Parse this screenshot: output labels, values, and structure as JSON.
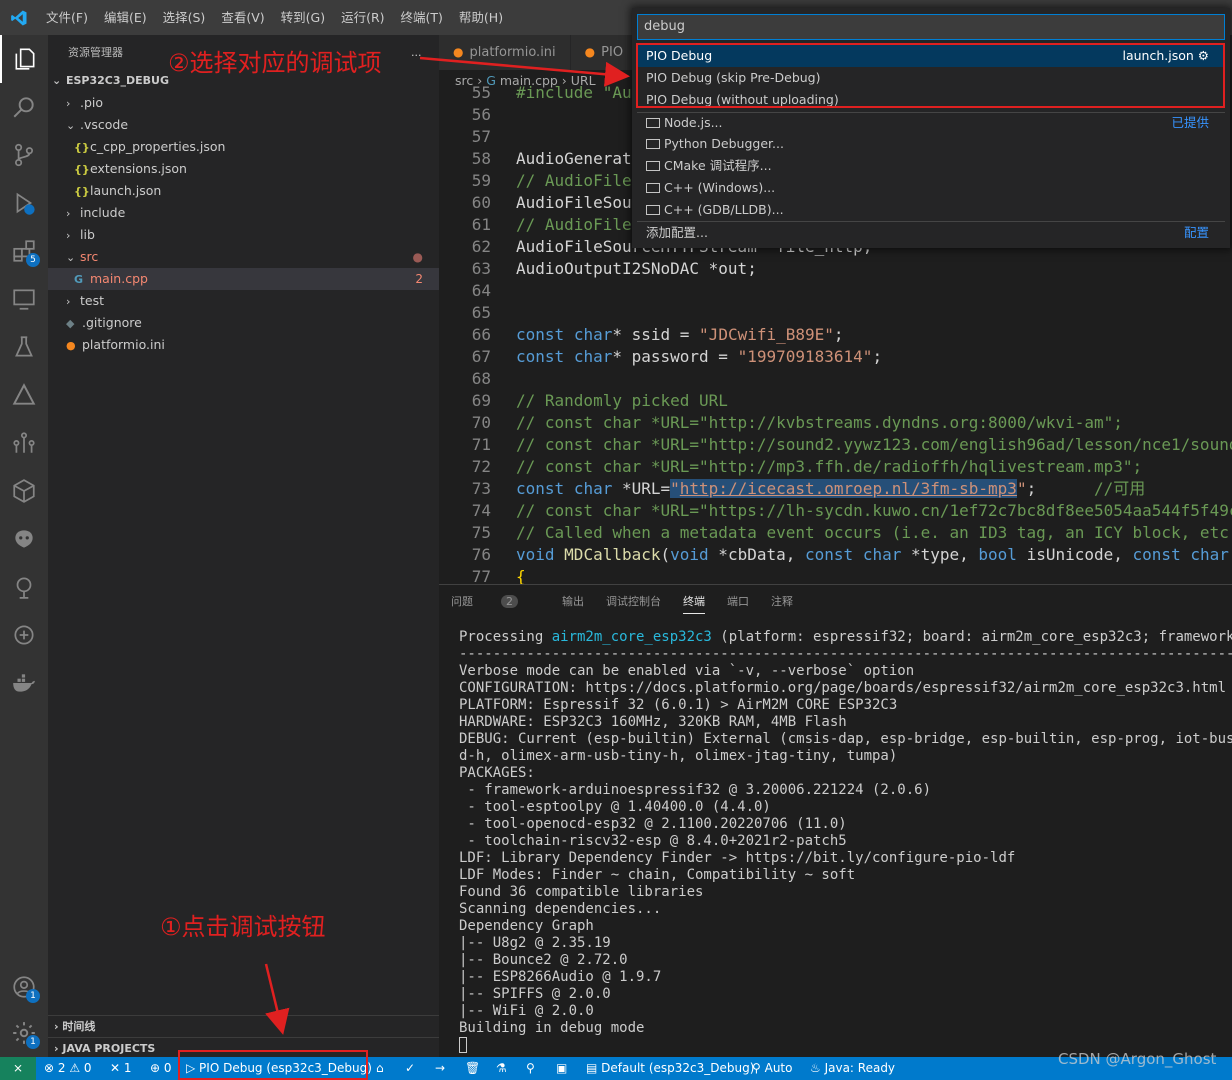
{
  "menu": [
    "文件(F)",
    "编辑(E)",
    "选择(S)",
    "查看(V)",
    "转到(G)",
    "运行(R)",
    "终端(T)",
    "帮助(H)"
  ],
  "sidebar": {
    "title": "资源管理器",
    "more": "...",
    "project": "ESP32C3_DEBUG",
    "items": [
      {
        "label": ".pio"
      },
      {
        "label": ".vscode"
      },
      {
        "label": "c_cpp_properties.json"
      },
      {
        "label": "extensions.json"
      },
      {
        "label": "launch.json"
      },
      {
        "label": "include"
      },
      {
        "label": "lib"
      },
      {
        "label": "src"
      },
      {
        "label": "main.cpp",
        "count": "2"
      },
      {
        "label": "test"
      },
      {
        "label": ".gitignore"
      },
      {
        "label": "platformio.ini"
      }
    ],
    "timeline": "时间线",
    "java_projects": "JAVA PROJECTS"
  },
  "activity_badges": {
    "extensions": "5",
    "accounts": "1",
    "settings": "1"
  },
  "tabs": [
    {
      "label": "platformio.ini"
    },
    {
      "label": "PIO"
    }
  ],
  "breadcrumb": {
    "folder": "src",
    "file": "main.cpp",
    "symbol": "URL"
  },
  "code": {
    "line_numbers": [
      "55",
      "56",
      "57",
      "58",
      "59",
      "60",
      "61",
      "62",
      "63",
      "64",
      "65",
      "66",
      "67",
      "68",
      "69",
      "70",
      "71",
      "72",
      "73",
      "74",
      "75",
      "76",
      "77"
    ],
    "l55": "#include \"Au",
    "l58": "AudioGenerat",
    "l59": "// AudioFile",
    "l60": "AudioFileSou",
    "l61": "// AudioFile",
    "l62": "AudioFileSourceHTTPStream *file_http;",
    "l63": "AudioOutputI2SNoDAC *out;",
    "l66": {
      "kw1": "const",
      "kw2": "char",
      "mid": "* ssid = ",
      "str": "\"JDCwifi_B89E\"",
      "end": ";"
    },
    "l67": {
      "kw1": "const",
      "kw2": "char",
      "mid": "* password = ",
      "str": "\"199709183614\"",
      "end": ";"
    },
    "l69": "// Randomly picked URL",
    "l70": "// const char *URL=\"http://kvbstreams.dyndns.org:8000/wkvi-am\";",
    "l71": "// const char *URL=\"http://sound2.yywz123.com/english96ad/lesson/nce1/sound",
    "l72": "// const char *URL=\"http://mp3.ffh.de/radioffh/hqlivestream.mp3\";",
    "l73": {
      "kw1": "const",
      "kw2": "char",
      "mid": " *URL=",
      "q1": "\"",
      "url": "http://icecast.omroep.nl/3fm-sb-mp3",
      "q2": "\"",
      "end": ";",
      "comment": "//可用"
    },
    "l74": "// const char *URL=\"https://lh-sycdn.kuwo.cn/1ef72c7bc8df8ee5054aa544f5f49c",
    "l75": "// Called when a metadata event occurs (i.e. an ID3 tag, an ICY block, etc.",
    "l76": {
      "kw": "void",
      "fn": "MDCallback",
      "p1": "(",
      "kw2": "void",
      "p2": " *cbData, ",
      "kw3": "const",
      "kw4": "char",
      "p3": " *type, ",
      "kw5": "bool",
      "p4": " isUnicode, ",
      "kw6": "const",
      "kw7": "char"
    },
    "l77": "{"
  },
  "panel": {
    "tabs": [
      "问题",
      "输出",
      "调试控制台",
      "终端",
      "端口",
      "注释"
    ],
    "problems_count": "2",
    "active_tab": "终端"
  },
  "terminal": {
    "processing": {
      "pre": "Processing ",
      "env": "airm2m_core_esp32c3",
      "post": " (platform: espressif32; board: airm2m_core_esp32c3; framework: ard"
    },
    "lines": [
      "--------------------------------------------------------------------------------------------------------------",
      "Verbose mode can be enabled via `-v, --verbose` option",
      "CONFIGURATION: https://docs.platformio.org/page/boards/espressif32/airm2m_core_esp32c3.html",
      "PLATFORM: Espressif 32 (6.0.1) > AirM2M CORE ESP32C3",
      "HARDWARE: ESP32C3 160MHz, 320KB RAM, 4MB Flash",
      "DEBUG: Current (esp-builtin) External (cmsis-dap, esp-bridge, esp-builtin, esp-prog, iot-bus-jtag",
      "d-h, olimex-arm-usb-tiny-h, olimex-jtag-tiny, tumpa)",
      "PACKAGES:",
      " - framework-arduinoespressif32 @ 3.20006.221224 (2.0.6)",
      " - tool-esptoolpy @ 1.40400.0 (4.4.0)",
      " - tool-openocd-esp32 @ 2.1100.20220706 (11.0)",
      " - toolchain-riscv32-esp @ 8.4.0+2021r2-patch5",
      "LDF: Library Dependency Finder -> https://bit.ly/configure-pio-ldf",
      "LDF Modes: Finder ~ chain, Compatibility ~ soft",
      "Found 36 compatible libraries",
      "Scanning dependencies...",
      "Dependency Graph",
      "|-- U8g2 @ 2.35.19",
      "|-- Bounce2 @ 2.72.0",
      "|-- ESP8266Audio @ 1.9.7",
      "|-- SPIFFS @ 2.0.0",
      "|-- WiFi @ 2.0.0",
      "Building in debug mode"
    ]
  },
  "quickpick": {
    "query": "debug",
    "items": [
      {
        "label": "PIO Debug",
        "right": "launch.json"
      },
      {
        "label": "PIO Debug (skip Pre-Debug)"
      },
      {
        "label": "PIO Debug (without uploading)"
      }
    ],
    "providers": [
      "Node.js...",
      "Python Debugger...",
      "CMake 调试程序...",
      "C++ (Windows)...",
      "C++ (GDB/LLDB)..."
    ],
    "provided_label": "已提供",
    "add_config": "添加配置...",
    "config_label": "配置"
  },
  "statusbar": {
    "errors": "2",
    "warnings": "0",
    "tools": "1",
    "ports": "0",
    "debug_config": "PIO Debug (esp32c3_Debug)",
    "env": "Default (esp32c3_Debug)",
    "auto": "Auto",
    "java": "Java: Ready"
  },
  "annotations": {
    "step1": "①点击调试按钮",
    "step2": "②选择对应的调试项"
  },
  "watermark": "CSDN @Argon_Ghost",
  "colors": {
    "accent": "#007acc",
    "annotation": "#e02020",
    "selection": "#04395e"
  }
}
